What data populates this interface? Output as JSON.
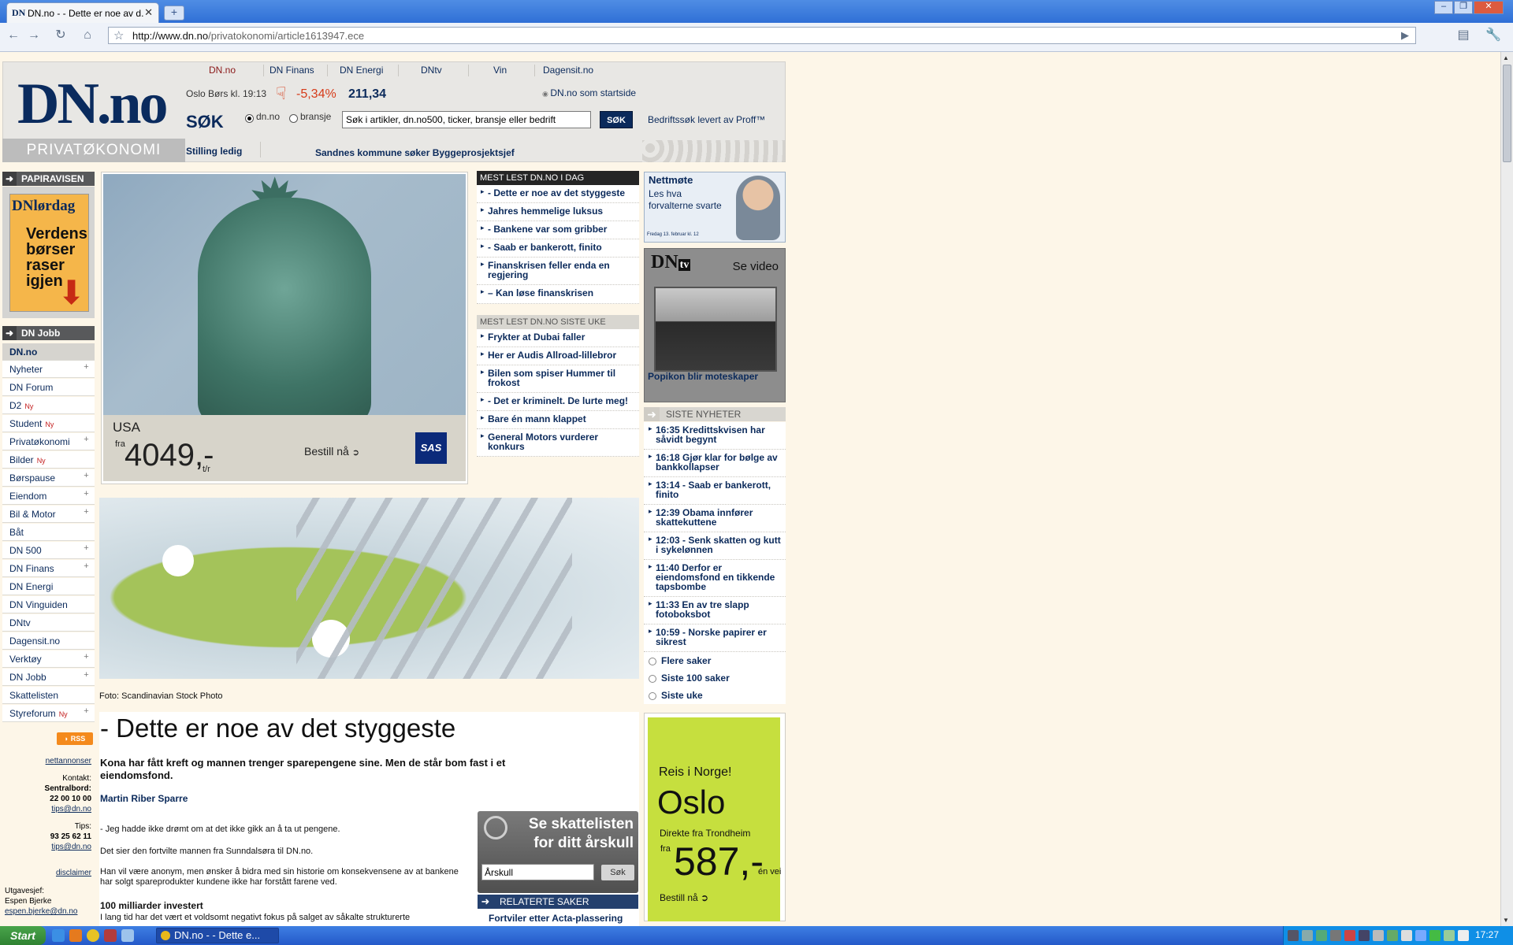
{
  "browser": {
    "tab_title": "DN.no - - Dette er noe av d...",
    "tab_favicon": "DN",
    "new_tab": "+",
    "url_host": "http://www.dn.no",
    "url_path": "/privatokonomi/article1613947.ece"
  },
  "header": {
    "logo": "DN.no",
    "logo_sub": "PRIVATØKONOMI",
    "topnav": [
      "DN.no",
      "DN Finans",
      "DN Energi",
      "DNtv",
      "Vin",
      "Dagensit.no"
    ],
    "bors_label": "Oslo Børs kl. 19:13",
    "bors_change": "-5,34%",
    "bors_value": "211,34",
    "startside": "DN.no som startside",
    "sok_label": "SØK",
    "radio_dn": "dn.no",
    "radio_bransje": "bransje",
    "search_value": "Søk i artikler, dn.no500, ticker, bransje eller bedrift",
    "sok_button": "SØK",
    "bedriftssok": "Bedriftssøk levert av Proff™",
    "stilling": "Stilling ledig",
    "sandnes": "Sandnes kommune søker Byggeprosjektsjef"
  },
  "left": {
    "papiravisen": "PAPIRAVISEN",
    "papir_mast": "DNlørdag",
    "papir_headline": "Verdens børser raser igjen",
    "dnjobb": "DN Jobb",
    "nav": [
      {
        "label": "DN.no",
        "ny": "",
        "plus": ""
      },
      {
        "label": "Nyheter",
        "ny": "",
        "plus": "+"
      },
      {
        "label": "DN Forum",
        "ny": "",
        "plus": ""
      },
      {
        "label": "D2",
        "ny": "Ny",
        "plus": ""
      },
      {
        "label": "Student",
        "ny": "Ny",
        "plus": ""
      },
      {
        "label": "Privatøkonomi",
        "ny": "",
        "plus": "+"
      },
      {
        "label": "Bilder",
        "ny": "Ny",
        "plus": ""
      },
      {
        "label": "Børspause",
        "ny": "",
        "plus": "+"
      },
      {
        "label": "Eiendom",
        "ny": "",
        "plus": "+"
      },
      {
        "label": "Bil & Motor",
        "ny": "",
        "plus": "+"
      },
      {
        "label": "Båt",
        "ny": "",
        "plus": ""
      },
      {
        "label": "DN 500",
        "ny": "",
        "plus": "+"
      },
      {
        "label": "DN Finans",
        "ny": "",
        "plus": "+"
      },
      {
        "label": "DN Energi",
        "ny": "",
        "plus": ""
      },
      {
        "label": "DN Vinguiden",
        "ny": "",
        "plus": ""
      },
      {
        "label": "DNtv",
        "ny": "",
        "plus": ""
      },
      {
        "label": "Dagensit.no",
        "ny": "",
        "plus": ""
      },
      {
        "label": "Verktøy",
        "ny": "",
        "plus": "+"
      },
      {
        "label": "DN Jobb",
        "ny": "",
        "plus": "+"
      },
      {
        "label": "Skattelisten",
        "ny": "",
        "plus": ""
      },
      {
        "label": "Styreforum",
        "ny": "Ny",
        "plus": "+"
      }
    ],
    "rss": "RSS",
    "nettannonser": "nettannonser",
    "kontakt": "Kontakt:",
    "sentralbord": "Sentralbord:",
    "sentralbord_nr": "22 00 10 00",
    "tips_mail": "tips@dn.no",
    "tips": "Tips:",
    "tips_nr": "93 25 62 11",
    "tips_mail2": "tips@dn.no",
    "disclaimer": "disclaimer",
    "utgavesjef": "Utgavesjef:",
    "utgavesjef_name": "Espen Bjerke",
    "utgavesjef_mail": "espen.bjerke@dn.no"
  },
  "sas_ad": {
    "dest": "USA",
    "fra": "fra",
    "price": "4049,-",
    "unit": "t/r",
    "cta": "Bestill nå",
    "logo": "SAS"
  },
  "mest_lest": {
    "dag_heading": "MEST LEST DN.NO I DAG",
    "dag": [
      "- Dette er noe av det styggeste",
      "Jahres hemmelige luksus",
      "- Bankene var som gribber",
      "- Saab er bankerott, finito",
      "Finanskrisen feller enda en regjering",
      "– Kan løse finanskrisen"
    ],
    "uke_heading": "MEST LEST DN.NO SISTE UKE",
    "uke": [
      "Frykter at Dubai faller",
      "Her er Audis Allroad-lillebror",
      "Bilen som spiser Hummer til frokost",
      "- Det er kriminelt. De lurte meg!",
      "Bare én mann klappet",
      "General Motors vurderer konkurs"
    ]
  },
  "right": {
    "nettmote_title": "Nettmøte",
    "nettmote_sub": "Les hva forvalterne svarte",
    "nettmote_date": "Fredag 13. februar kl. 12",
    "dntv_logo": "DN",
    "dntv_tv": "tv",
    "se_video": "Se video",
    "video_caption": "Popikon blir moteskaper",
    "siste_heading": "SISTE NYHETER",
    "siste": [
      "16:35  Kredittskvisen har såvidt begynt",
      "16:18  Gjør klar for bølge av bankkollapser",
      "13:14  - Saab er bankerott, finito",
      "12:39  Obama innfører skattekuttene",
      "12:03  - Senk skatten og kutt i sykelønnen",
      "11:40  Derfor er eiendomsfond en tikkende tapsbombe",
      "11:33  En av tre slapp fotoboksbot",
      "10:59  - Norske papirer er sikrest"
    ],
    "links": [
      "Flere saker",
      "Siste 100 saker",
      "Siste uke"
    ]
  },
  "oslo_ad": {
    "reis": "Reis i Norge!",
    "city": "Oslo",
    "direkte": "Direkte fra Trondheim",
    "fra": "fra",
    "price": "587,-",
    "unit": "én vei",
    "cta": "Bestill nå"
  },
  "article": {
    "photo_credit": "Foto: Scandinavian Stock Photo",
    "title": "- Dette er noe av det styggeste",
    "lead": "Kona har fått kreft og mannen trenger sparepengene sine. Men de står bom fast i et eiendomsfond.",
    "author": "Martin Riber Sparre",
    "paragraphs": [
      "- Jeg hadde ikke drømt om at det ikke gikk an å ta ut pengene.",
      "Det sier den fortvilte mannen fra Sunndalsøra til DN.no.",
      "Han vil være anonym, men ønsker å bidra med sin historie om konsekvensene av at bankene har solgt spareprodukter kundene ikke har forstått farene ved."
    ],
    "subheading": "100 milliarder investert",
    "cut_text": "I lang tid har det vært et voldsomt negativt fokus på salget av såkalte strukturerte"
  },
  "skatteliste": {
    "title": "Se skattelisten for ditt årskull",
    "input_value": "Årskull",
    "button": "Søk",
    "related_heading": "RELATERTE SAKER",
    "related_1": "Fortviler etter Acta-plassering"
  },
  "taskbar": {
    "start": "Start",
    "item": "DN.no - - Dette e...",
    "clock": "17:27"
  },
  "colors": {
    "brand_navy": "#0b2a5b",
    "alert_red": "#d63b19",
    "page_bg": "#fdf6e8",
    "oslo_green": "#c6df3e"
  }
}
